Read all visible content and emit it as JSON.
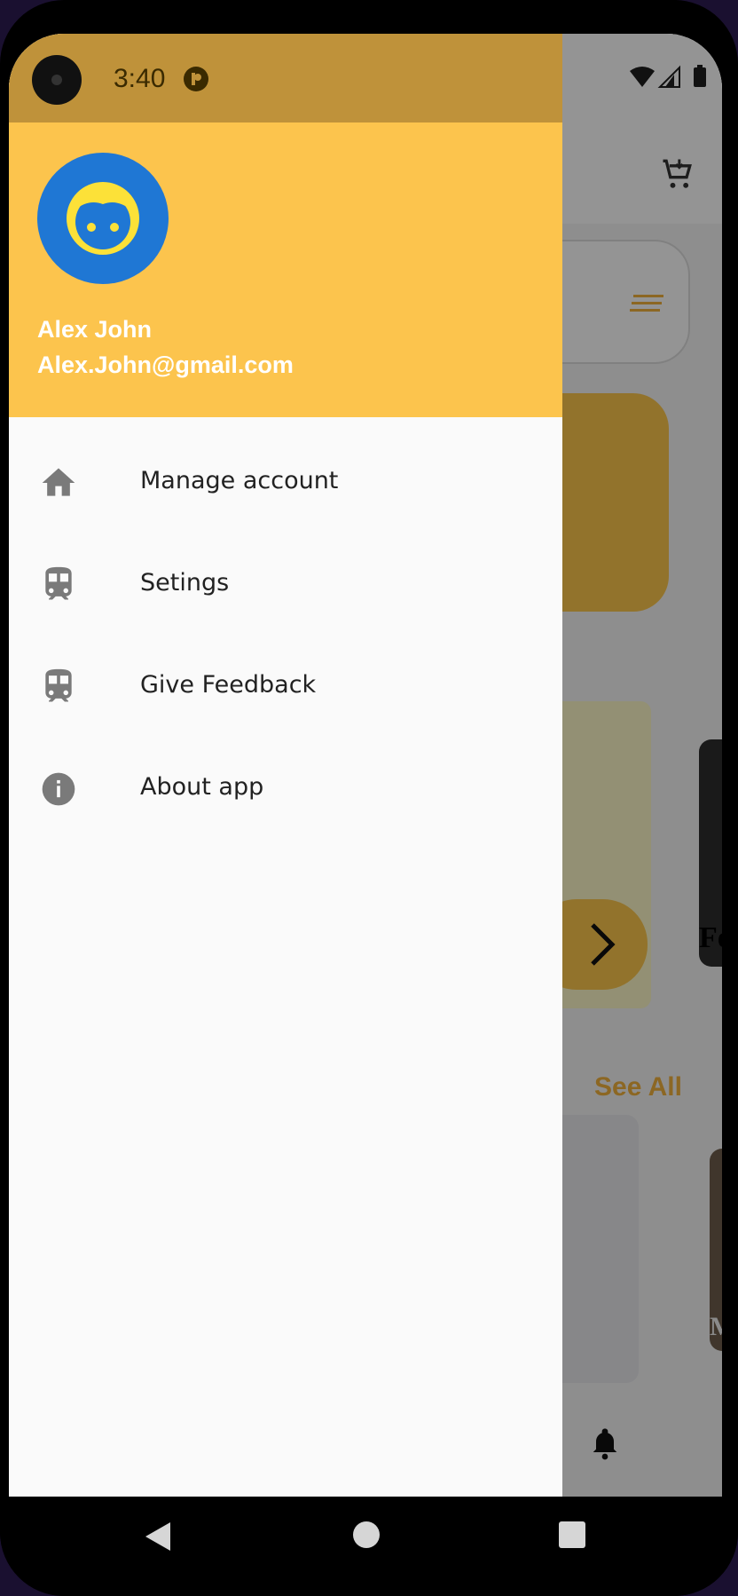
{
  "status_bar": {
    "time": "3:40"
  },
  "drawer": {
    "user": {
      "name": "Alex John",
      "email": "Alex.John@gmail.com"
    },
    "items": [
      {
        "label": "Manage account",
        "icon": "home-icon"
      },
      {
        "label": "Setings",
        "icon": "train-icon"
      },
      {
        "label": "Give Feedback",
        "icon": "train-icon"
      },
      {
        "label": "About app",
        "icon": "info-icon"
      }
    ]
  },
  "background": {
    "see_all": "See All",
    "thumb_text": "Fo",
    "thumb_text_2": "M"
  },
  "colors": {
    "header": "#fcc44d",
    "avatar": "#1f77d4",
    "accent": "#f2b13d"
  }
}
